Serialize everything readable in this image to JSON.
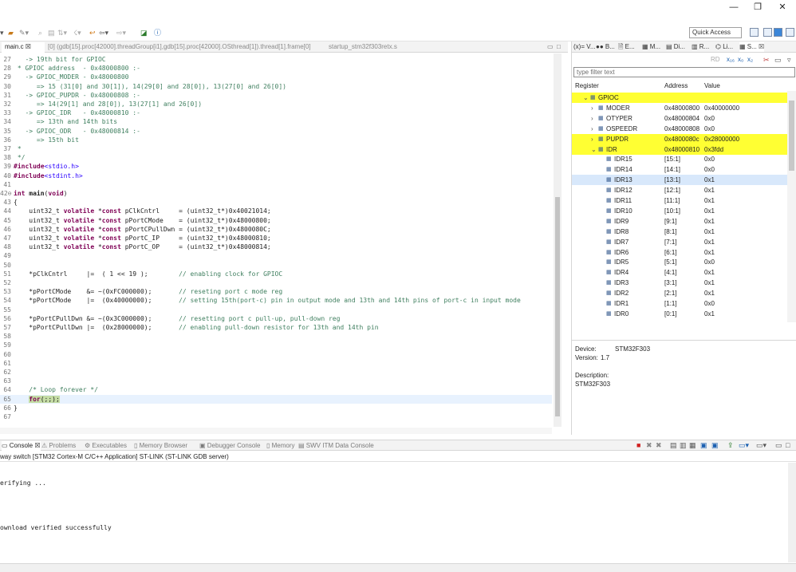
{
  "window": {
    "minimize_glyph": "—",
    "restore_glyph": "❐",
    "close_glyph": "✕"
  },
  "toolbar": {
    "quick_access": "Quick Access"
  },
  "editor_tabs": [
    {
      "label": "main.c ☒",
      "active": true
    },
    {
      "label": "[0] (gdb[15].proc[42000].threadGroup[i1],gdb[15].proc[42000].OSthread[1]).thread[1].frame[0]",
      "active": false
    },
    {
      "label": "startup_stm32f303retx.s",
      "active": false
    }
  ],
  "code_lines": [
    {
      "n": "27",
      "html": "<span class=\"cmt\">   -&gt; 19th bit for GPIOC</span>"
    },
    {
      "n": "28",
      "html": "<span class=\"cmt\"> * GPIOC address  - 0x48000800 :-</span>"
    },
    {
      "n": "29",
      "html": "<span class=\"cmt\">   -&gt; GPIOC_MODER - 0x48000800</span>"
    },
    {
      "n": "30",
      "html": "<span class=\"cmt\">      =&gt; 15 (31[0] and 30[1]), 14(29[0] and 28[0]), 13(27[0] and 26[0])</span>"
    },
    {
      "n": "31",
      "html": "<span class=\"cmt\">   -&gt; GPIOC_PUPDR - 0x48000808 :-</span>"
    },
    {
      "n": "32",
      "html": "<span class=\"cmt\">      =&gt; 14(29[1] and 28[0]), 13(27[1] and 26[0])</span>"
    },
    {
      "n": "33",
      "html": "<span class=\"cmt\">   -&gt; GPIOC_IDR   - 0x48000810 :-</span>"
    },
    {
      "n": "34",
      "html": "<span class=\"cmt\">      =&gt; 13th and 14th bits</span>"
    },
    {
      "n": "35",
      "html": "<span class=\"cmt\">   -&gt; GPIOC_ODR   - 0x48000814 :-</span>"
    },
    {
      "n": "36",
      "html": "<span class=\"cmt\">      =&gt; 15th bit</span>"
    },
    {
      "n": "37",
      "html": "<span class=\"cmt\"> *</span>"
    },
    {
      "n": "38",
      "html": "<span class=\"cmt\"> */</span>"
    },
    {
      "n": "39",
      "html": "<span class=\"inc\">#include</span><span class=\"str\">&lt;stdio.h&gt;</span>"
    },
    {
      "n": "40",
      "html": "<span class=\"inc\">#include</span><span class=\"str\">&lt;stdint.h&gt;</span>"
    },
    {
      "n": "41",
      "html": ""
    },
    {
      "n": "42⊖",
      "html": "<span class=\"kw\">int</span> <b>main</b>(<span class=\"kw\">void</span>)"
    },
    {
      "n": "43",
      "html": "{"
    },
    {
      "n": "44",
      "html": "    uint32_t <span class=\"kw\">volatile</span> *<span class=\"kw\">const</span> pClkCntrl     = (uint32_t*)0x40021014;"
    },
    {
      "n": "45",
      "html": "    uint32_t <span class=\"kw\">volatile</span> *<span class=\"kw\">const</span> pPortCMode    = (uint32_t*)0x48000800;"
    },
    {
      "n": "46",
      "html": "    uint32_t <span class=\"kw\">volatile</span> *<span class=\"kw\">const</span> pPortCPullDwn = (uint32_t*)0x4800080C;"
    },
    {
      "n": "47",
      "html": "    uint32_t <span class=\"kw\">volatile</span> *<span class=\"kw\">const</span> pPortC_IP     = (uint32_t*)0x48000810;"
    },
    {
      "n": "48",
      "html": "    uint32_t <span class=\"kw\">volatile</span> *<span class=\"kw\">const</span> pPortC_OP     = (uint32_t*)0x48000814;"
    },
    {
      "n": "49",
      "html": ""
    },
    {
      "n": "50",
      "html": ""
    },
    {
      "n": "51",
      "html": "    *pClkCntrl     |=  ( 1 &lt;&lt; 19 );        <span class=\"cmt\">// enabling clock for GPIOC</span>"
    },
    {
      "n": "52",
      "html": ""
    },
    {
      "n": "53",
      "html": "    *pPortCMode    &amp;= ~(0xFC000000);       <span class=\"cmt\">// reseting port c mode reg</span>"
    },
    {
      "n": "54",
      "html": "    *pPortCMode    |=  (0x40000000);       <span class=\"cmt\">// setting 15th(port-c) pin in output mode and 13th and 14th pins of port-c in input mode</span>"
    },
    {
      "n": "55",
      "html": ""
    },
    {
      "n": "56",
      "html": "    *pPortCPullDwn &amp;= ~(0x3C000000);       <span class=\"cmt\">// resetting port c pull-up, pull-down reg</span>"
    },
    {
      "n": "57",
      "html": "    *pPortCPullDwn |=  (0x28000000);       <span class=\"cmt\">// enabling pull-down resistor for 13th and 14th pin</span>"
    },
    {
      "n": "58",
      "html": ""
    },
    {
      "n": "59",
      "html": ""
    },
    {
      "n": "60",
      "html": ""
    },
    {
      "n": "61",
      "html": ""
    },
    {
      "n": "62",
      "html": ""
    },
    {
      "n": "63",
      "html": ""
    },
    {
      "n": "64",
      "html": "    <span class=\"cmt\">/* Loop forever */</span>"
    },
    {
      "n": "65",
      "html": "    <span class=\"bp\"><span class=\"kw\">for</span>(;;);</span>",
      "hl": true
    },
    {
      "n": "66",
      "html": "}"
    },
    {
      "n": "67",
      "html": ""
    }
  ],
  "right_tabs": [
    "(x)= V...",
    "●● B...",
    "🗎 E...",
    "▦ M...",
    "▤ Di...",
    "▥ R...",
    "⌬ Li...",
    "▦ S... ☒"
  ],
  "registers": {
    "filter_placeholder": "type filter text",
    "header": {
      "register": "Register",
      "address": "Address",
      "value": "Value"
    },
    "rows": [
      {
        "indent": 1,
        "twisty": "⌄",
        "name": "GPIOC",
        "address": "",
        "value": "",
        "yellow": true
      },
      {
        "indent": 2,
        "twisty": "›",
        "name": "MODER",
        "address": "0x48000800",
        "value": "0x40000000"
      },
      {
        "indent": 2,
        "twisty": "›",
        "name": "OTYPER",
        "address": "0x48000804",
        "value": "0x0"
      },
      {
        "indent": 2,
        "twisty": "›",
        "name": "OSPEEDR",
        "address": "0x48000808",
        "value": "0x0"
      },
      {
        "indent": 2,
        "twisty": "›",
        "name": "PUPDR",
        "address": "0x4800080c",
        "value": "0x28000000",
        "yellow": true
      },
      {
        "indent": 2,
        "twisty": "⌄",
        "name": "IDR",
        "address": "0x48000810",
        "value": "0x3fdd",
        "yellow": true
      },
      {
        "indent": 3,
        "twisty": "",
        "name": "IDR15",
        "address": "[15:1]",
        "value": "0x0"
      },
      {
        "indent": 3,
        "twisty": "",
        "name": "IDR14",
        "address": "[14:1]",
        "value": "0x0"
      },
      {
        "indent": 3,
        "twisty": "",
        "name": "IDR13",
        "address": "[13:1]",
        "value": "0x1",
        "sel": true
      },
      {
        "indent": 3,
        "twisty": "",
        "name": "IDR12",
        "address": "[12:1]",
        "value": "0x1"
      },
      {
        "indent": 3,
        "twisty": "",
        "name": "IDR11",
        "address": "[11:1]",
        "value": "0x1"
      },
      {
        "indent": 3,
        "twisty": "",
        "name": "IDR10",
        "address": "[10:1]",
        "value": "0x1"
      },
      {
        "indent": 3,
        "twisty": "",
        "name": "IDR9",
        "address": "[9:1]",
        "value": "0x1"
      },
      {
        "indent": 3,
        "twisty": "",
        "name": "IDR8",
        "address": "[8:1]",
        "value": "0x1"
      },
      {
        "indent": 3,
        "twisty": "",
        "name": "IDR7",
        "address": "[7:1]",
        "value": "0x1"
      },
      {
        "indent": 3,
        "twisty": "",
        "name": "IDR6",
        "address": "[6:1]",
        "value": "0x1"
      },
      {
        "indent": 3,
        "twisty": "",
        "name": "IDR5",
        "address": "[5:1]",
        "value": "0x0"
      },
      {
        "indent": 3,
        "twisty": "",
        "name": "IDR4",
        "address": "[4:1]",
        "value": "0x1"
      },
      {
        "indent": 3,
        "twisty": "",
        "name": "IDR3",
        "address": "[3:1]",
        "value": "0x1"
      },
      {
        "indent": 3,
        "twisty": "",
        "name": "IDR2",
        "address": "[2:1]",
        "value": "0x1"
      },
      {
        "indent": 3,
        "twisty": "",
        "name": "IDR1",
        "address": "[1:1]",
        "value": "0x0"
      },
      {
        "indent": 3,
        "twisty": "",
        "name": "IDR0",
        "address": "[0:1]",
        "value": "0x1"
      }
    ]
  },
  "device_info": {
    "device_label": "Device:",
    "device": "STM32F303",
    "version_label": "Version:",
    "version": "1.7",
    "description_label": "Description:",
    "description": "STM32F303"
  },
  "console_tabs": [
    {
      "label": "▭ Console ☒",
      "active": true
    },
    {
      "label": "⚠ Problems",
      "active": false
    },
    {
      "label": "⚙ Executables",
      "active": false
    },
    {
      "label": "▯ Memory Browser",
      "active": false
    },
    {
      "label": "▣ Debugger Console",
      "active": false
    },
    {
      "label": "▯ Memory",
      "active": false
    },
    {
      "label": "▤ SWV ITM Data Console",
      "active": false
    }
  ],
  "console": {
    "title": "way switch [STM32 Cortex-M C/C++ Application] ST-LINK (ST-LINK GDB server)",
    "lines": [
      "erifying ...",
      "ownload verified successfully"
    ]
  },
  "colors": {
    "highlight_yellow": "#ffff33",
    "comment_green": "#3f7f5f",
    "keyword_purple": "#7f0055",
    "include_string_blue": "#2a00ff",
    "selected_row": "#d8e8fb"
  }
}
